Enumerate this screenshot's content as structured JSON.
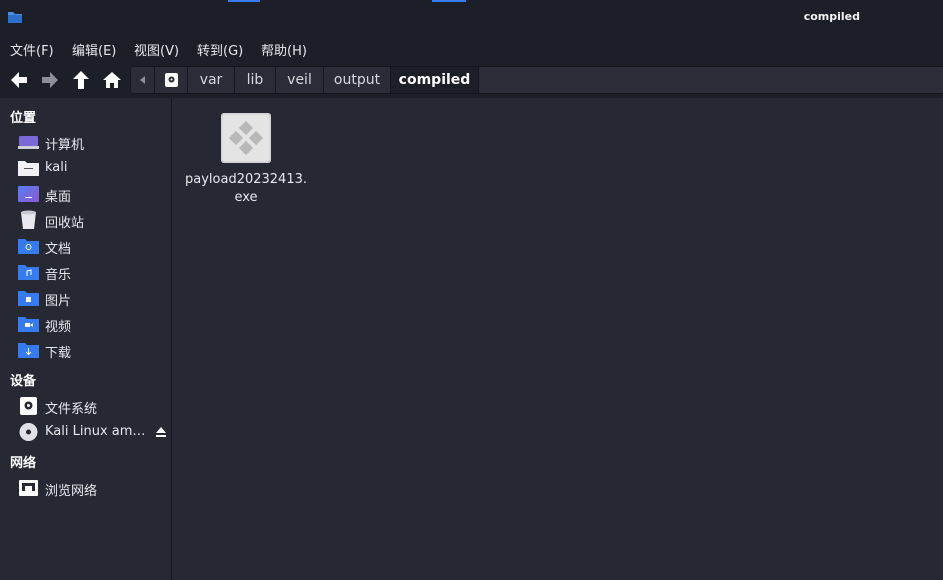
{
  "window": {
    "title": "compiled"
  },
  "menubar": {
    "items": [
      "文件(F)",
      "编辑(E)",
      "视图(V)",
      "转到(G)",
      "帮助(H)"
    ]
  },
  "toolbar": {
    "buttons": [
      "back-arrow-icon",
      "forward-arrow-icon",
      "up-arrow-icon",
      "home-icon"
    ],
    "breadcrumbs": [
      "var",
      "lib",
      "veil",
      "output",
      "compiled"
    ]
  },
  "sidebar": {
    "places_header": "位置",
    "places": [
      "计算机",
      "kali",
      "桌面",
      "回收站",
      "文档",
      "音乐",
      "图片",
      "视频",
      "下载"
    ],
    "devices_header": "设备",
    "devices": [
      "文件系统",
      "Kali Linux am…"
    ],
    "network_header": "网络",
    "network": [
      "浏览网络"
    ]
  },
  "content": {
    "files": [
      {
        "name": "payload20232413.exe",
        "icon": "exe-file-icon"
      }
    ]
  },
  "colors": {
    "background": "#262833",
    "chrome": "#1d1f28",
    "accent": "#367bf0"
  }
}
